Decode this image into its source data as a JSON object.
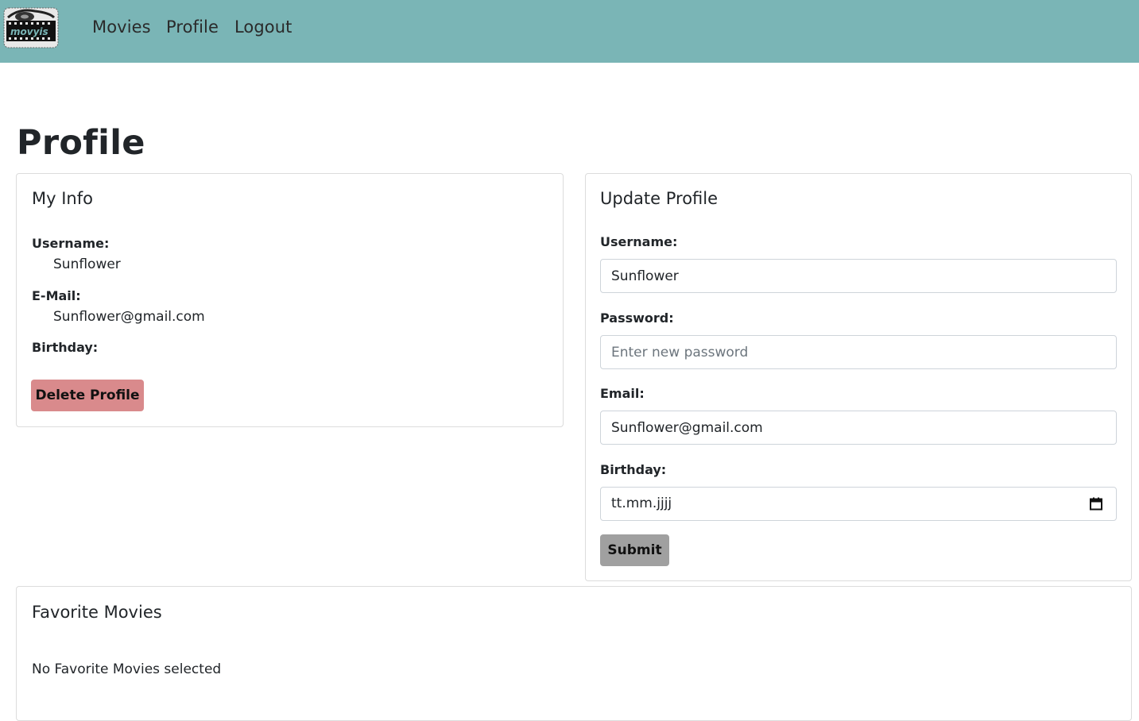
{
  "nav": {
    "logo_text": "movyis",
    "items": [
      {
        "label": "Movies"
      },
      {
        "label": "Profile"
      },
      {
        "label": "Logout"
      }
    ]
  },
  "page_title": "Profile",
  "my_info": {
    "title": "My Info",
    "username_label": "Username:",
    "username_value": "Sunflower",
    "email_label": "E-Mail:",
    "email_value": "Sunflower@gmail.com",
    "birthday_label": "Birthday:",
    "delete_button": "Delete Profile"
  },
  "update_profile": {
    "title": "Update Profile",
    "username_label": "Username:",
    "username_value": "Sunflower",
    "password_label": "Password:",
    "password_placeholder": "Enter new password",
    "email_label": "Email:",
    "email_value": "Sunflower@gmail.com",
    "birthday_label": "Birthday:",
    "birthday_placeholder": "tt.mm.jjjj",
    "submit_button": "Submit"
  },
  "favorites": {
    "title": "Favorite Movies",
    "empty_text": "No Favorite Movies selected"
  },
  "colors": {
    "navbar": "#7ab5b6",
    "delete_button": "#d98a8c",
    "submit_button": "#a0a0a0"
  },
  "icons": {
    "logo": "film-reel-logo-icon",
    "birthday_picker": "calendar-icon"
  }
}
